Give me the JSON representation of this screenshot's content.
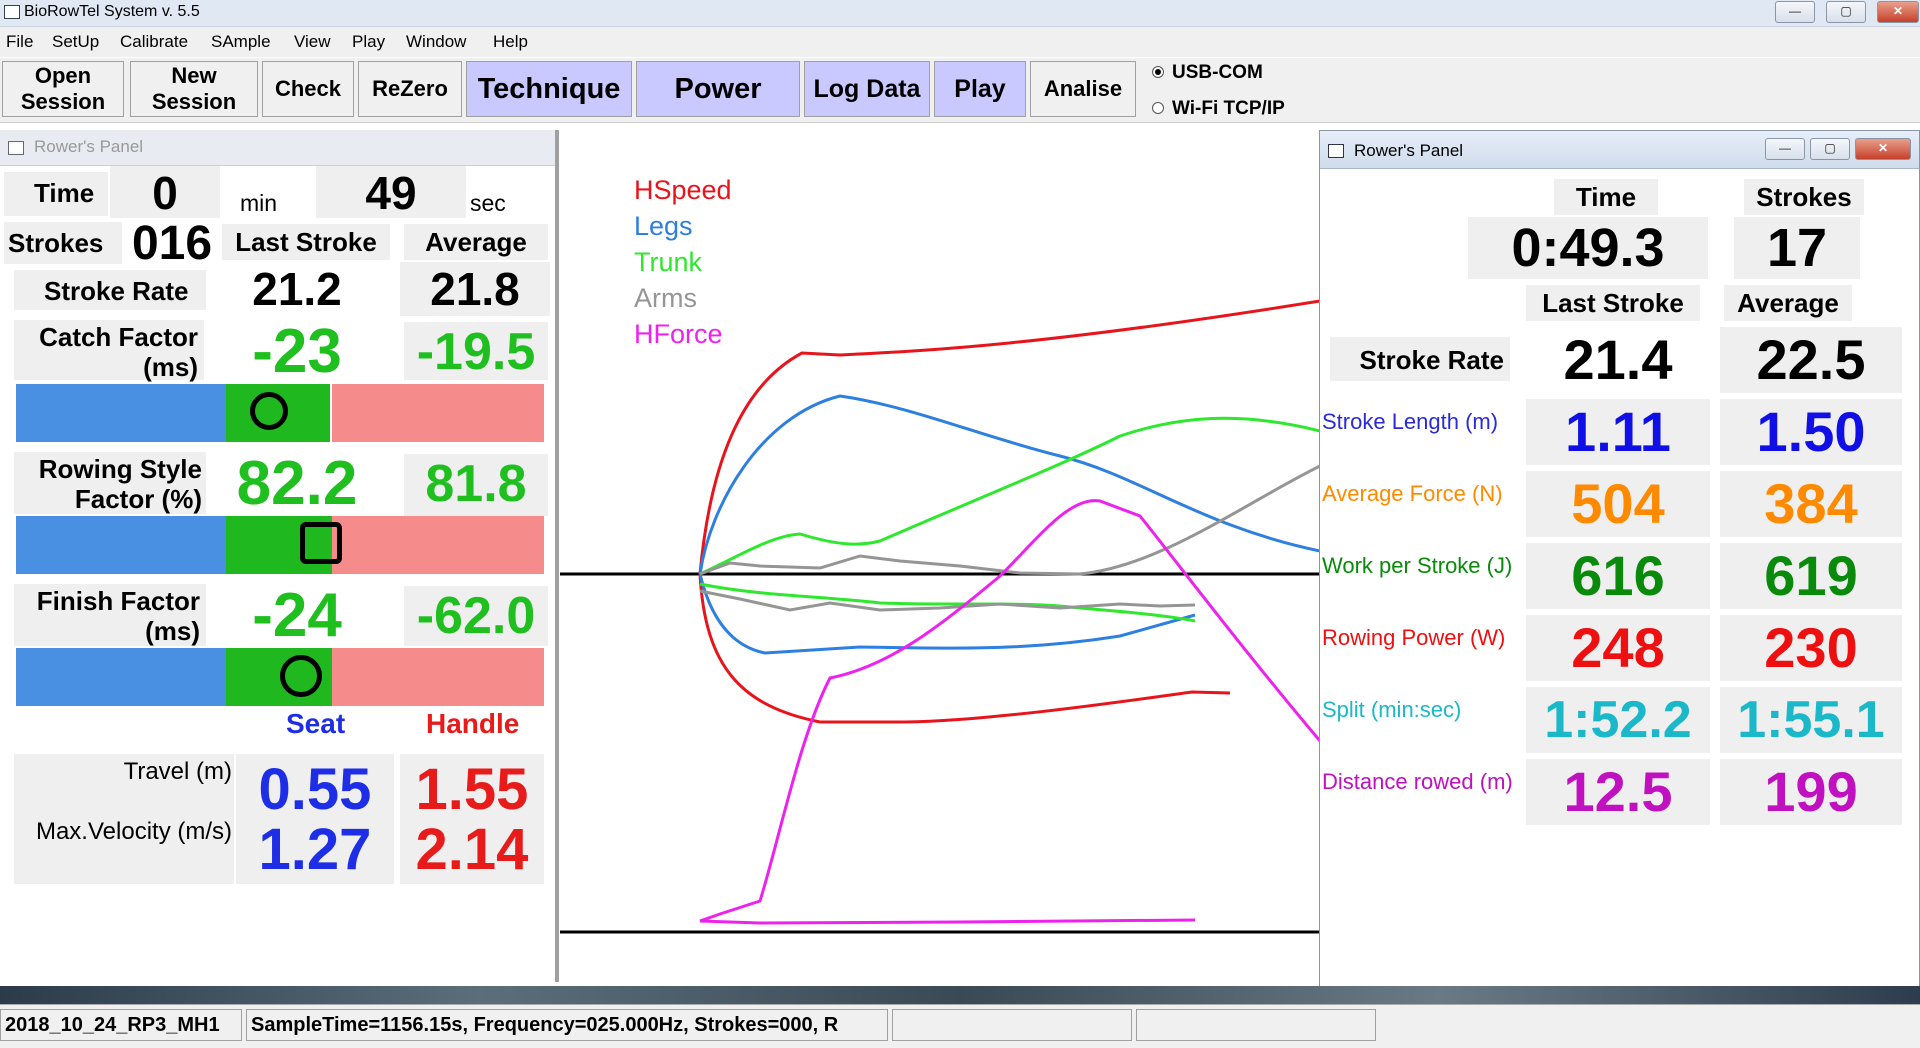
{
  "window": {
    "title": "BioRowTel System v. 5.5"
  },
  "menu": [
    "File",
    "SetUp",
    "Calibrate",
    "SAmple",
    "View",
    "Play",
    "Window",
    "Help"
  ],
  "toolbar": {
    "open_session_1": "Open",
    "open_session_2": "Session",
    "new_session_1": "New",
    "new_session_2": "Session",
    "check": "Check",
    "rezero": "ReZero",
    "technique": "Technique",
    "power": "Power",
    "log_data": "Log Data",
    "play": "Play",
    "analise": "Analise",
    "usb_com": "USB-COM",
    "wifi": "Wi-Fi TCP/IP"
  },
  "left_panel": {
    "title": "Rower's Panel",
    "time_label": "Time",
    "time_min": "0",
    "min_unit": "min",
    "time_sec": "49",
    "sec_unit": "sec",
    "strokes_label": "Strokes",
    "strokes": "016",
    "last_stroke": "Last Stroke",
    "average": "Average",
    "stroke_rate_label": "Stroke Rate",
    "stroke_rate_last": "21.2",
    "stroke_rate_avg": "21.8",
    "catch_label_1": "Catch Factor",
    "catch_label_2": "(ms)",
    "catch_last": "-23",
    "catch_avg": "-19.5",
    "style_label_1": "Rowing Style",
    "style_label_2": "Factor (%)",
    "style_last": "82.2",
    "style_avg": "81.8",
    "finish_label_1": "Finish Factor",
    "finish_label_2": "(ms)",
    "finish_last": "-24",
    "finish_avg": "-62.0",
    "seat": "Seat",
    "handle": "Handle",
    "travel_label": "Travel (m)",
    "travel_seat": "0.55",
    "travel_handle": "1.55",
    "maxvel_label": "Max.Velocity (m/s)",
    "maxvel_seat": "1.27",
    "maxvel_handle": "2.14"
  },
  "legend": [
    {
      "name": "HSpeed",
      "color": "#e8141b"
    },
    {
      "name": "Legs",
      "color": "#2d7fe0"
    },
    {
      "name": "Trunk",
      "color": "#2ee82e"
    },
    {
      "name": "Arms",
      "color": "#959595"
    },
    {
      "name": "HForce",
      "color": "#ee22ee"
    }
  ],
  "right_panel": {
    "title": "Rower's Panel",
    "time_label": "Time",
    "strokes_label": "Strokes",
    "time": "0:49.3",
    "strokes": "17",
    "last_stroke": "Last Stroke",
    "average": "Average",
    "rows": [
      {
        "label": "Stroke Rate",
        "last": "21.4",
        "avg": "22.5",
        "color": "#000000",
        "label_color": "#000000"
      },
      {
        "label": "Stroke Length (m)",
        "last": "1.11",
        "avg": "1.50",
        "color": "#1010e6",
        "label_color": "#2a2ad8"
      },
      {
        "label": "Average Force (N)",
        "last": "504",
        "avg": "384",
        "color": "#ff8a00",
        "label_color": "#ff8a00"
      },
      {
        "label": "Work per Stroke (J)",
        "last": "616",
        "avg": "619",
        "color": "#0a8a0a",
        "label_color": "#0a8a0a"
      },
      {
        "label": "Rowing Power (W)",
        "last": "248",
        "avg": "230",
        "color": "#ee1010",
        "label_color": "#ee1010"
      },
      {
        "label": "Split (min:sec)",
        "last": "1:52.2",
        "avg": "1:55.1",
        "color": "#1ab8c8",
        "label_color": "#1ab8c8"
      },
      {
        "label": "Distance rowed (m)",
        "last": "12.5",
        "avg": "199",
        "color": "#c010c0",
        "label_color": "#c010c0"
      }
    ]
  },
  "status": {
    "file": "2018_10_24_RP3_MH1",
    "info": "SampleTime=1156.15s, Frequency=025.000Hz, Strokes=000, R"
  }
}
